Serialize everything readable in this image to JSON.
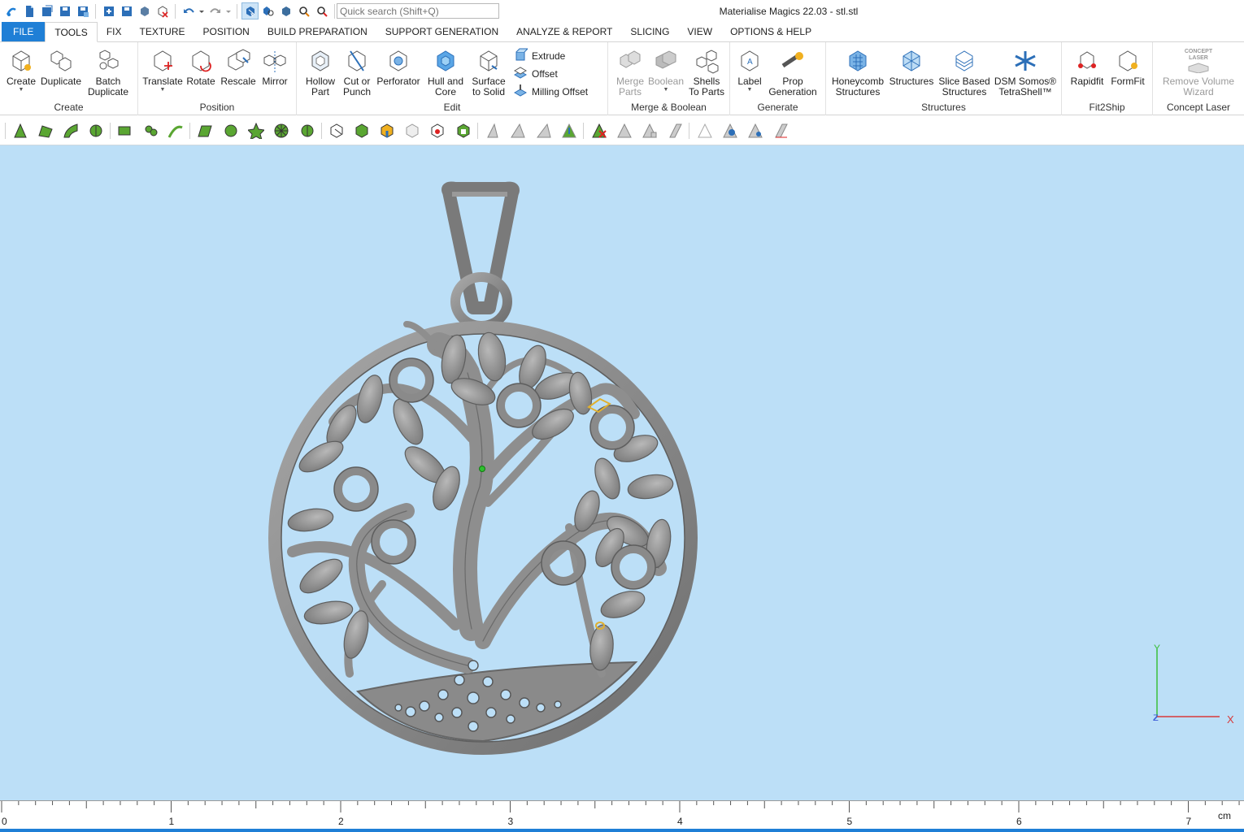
{
  "window": {
    "title": "Materialise Magics 22.03 - stl.stl"
  },
  "search": {
    "placeholder": "Quick search (Shift+Q)"
  },
  "tabs": [
    {
      "label": "FILE"
    },
    {
      "label": "TOOLS"
    },
    {
      "label": "FIX"
    },
    {
      "label": "TEXTURE"
    },
    {
      "label": "POSITION"
    },
    {
      "label": "BUILD PREPARATION"
    },
    {
      "label": "SUPPORT GENERATION"
    },
    {
      "label": "ANALYZE & REPORT"
    },
    {
      "label": "SLICING"
    },
    {
      "label": "VIEW"
    },
    {
      "label": "OPTIONS & HELP"
    }
  ],
  "active_tab": "TOOLS",
  "ribbon": {
    "create": {
      "label": "Create",
      "create": "Create",
      "duplicate": "Duplicate",
      "batch_duplicate_1": "Batch",
      "batch_duplicate_2": "Duplicate"
    },
    "position": {
      "label": "Position",
      "translate": "Translate",
      "rotate": "Rotate",
      "rescale": "Rescale",
      "mirror": "Mirror"
    },
    "edit": {
      "label": "Edit",
      "hollow_1": "Hollow",
      "hollow_2": "Part",
      "cut_1": "Cut or",
      "cut_2": "Punch",
      "perforator": "Perforator",
      "hull_1": "Hull and",
      "hull_2": "Core",
      "surface_1": "Surface",
      "surface_2": "to Solid",
      "extrude": "Extrude",
      "offset": "Offset",
      "milling_offset": "Milling Offset"
    },
    "merge": {
      "label": "Merge & Boolean",
      "merge_1": "Merge",
      "merge_2": "Parts",
      "boolean": "Boolean",
      "shells_1": "Shells",
      "shells_2": "To Parts"
    },
    "generate": {
      "label": "Generate",
      "label_btn": "Label",
      "prop_1": "Prop",
      "prop_2": "Generation"
    },
    "structures": {
      "label": "Structures",
      "honeycomb_1": "Honeycomb",
      "honeycomb_2": "Structures",
      "structures": "Structures",
      "slice_1": "Slice Based",
      "slice_2": "Structures",
      "dsm_1": "DSM Somos®",
      "dsm_2": "TetraShell™"
    },
    "fit2ship": {
      "label": "Fit2Ship",
      "rapidfit": "Rapidfit",
      "formfit": "FormFit"
    },
    "concept_laser": {
      "label": "Concept Laser",
      "logo_text": "CONCEPT LASER",
      "remove_1": "Remove Volume",
      "remove_2": "Wizard"
    }
  },
  "axes": {
    "y": "Y",
    "x": "X",
    "z": "Z"
  },
  "ruler": {
    "unit": "cm",
    "labels": [
      "0",
      "1",
      "2",
      "3",
      "4",
      "5",
      "6",
      "7"
    ]
  },
  "colors": {
    "accent": "#1f7fd6",
    "viewport": "#bcdff7",
    "model": "#8c8c8c"
  }
}
